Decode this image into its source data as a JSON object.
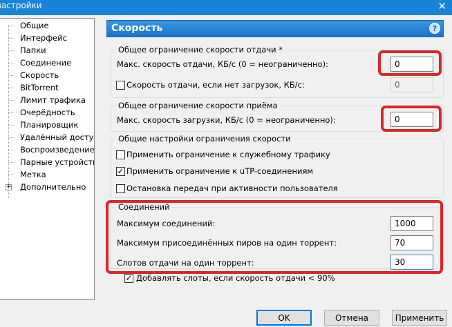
{
  "window": {
    "title": "настройки"
  },
  "tree": [
    {
      "label": "Общие"
    },
    {
      "label": "Интерфейс"
    },
    {
      "label": "Папки"
    },
    {
      "label": "Соединение"
    },
    {
      "label": "Скорость",
      "selected": true
    },
    {
      "label": "BitTorrent"
    },
    {
      "label": "Лимит трафика"
    },
    {
      "label": "Очерёдность"
    },
    {
      "label": "Планировщик"
    },
    {
      "label": "Удалённый доступ"
    },
    {
      "label": "Воспроизведение"
    },
    {
      "label": "Парные устройства"
    },
    {
      "label": "Метка"
    },
    {
      "label": "Дополнительно",
      "expandable": true
    }
  ],
  "header": {
    "title": "Скорость",
    "help": "?"
  },
  "upload": {
    "legend": "Общее ограничение скорости отдачи *",
    "max_label": "Макс. скорость отдачи, КБ/с (0 = неограниченно):",
    "max_value": "0",
    "no_download_label": "Скорость отдачи, если нет загрузок, КБ/с:",
    "no_download_checked": false,
    "no_download_value": "0"
  },
  "download": {
    "legend": "Общее ограничение скорости приёма",
    "max_label": "Макс. скорость загрузки, КБ/с (0 = неограниченно):",
    "max_value": "0"
  },
  "general": {
    "legend": "Общие настройки ограничения скорости",
    "options": [
      {
        "label": "Применить ограничение к служебному трафику",
        "checked": false
      },
      {
        "label": "Применить ограничение к uTP-соединениям",
        "checked": true
      },
      {
        "label": "Остановка передач при активности пользователя",
        "checked": false
      }
    ]
  },
  "connections": {
    "legend": "Соединений",
    "max_label": "Максимум соединений:",
    "max_value": "1000",
    "peers_label": "Максимум присоединённых пиров на один торрент:",
    "peers_value": "70",
    "slots_label": "Слотов отдачи на один торрент:",
    "slots_value": "30",
    "extra_slots_label": "Добавлять слоты, если скорость отдачи < 90%",
    "extra_slots_checked": true
  },
  "buttons": {
    "ok": "OK",
    "cancel": "Отмена",
    "apply": "Применить"
  },
  "colors": {
    "highlight": "#d9272a",
    "accent": "#1a73c8",
    "selection": "#0078d7"
  },
  "icons": {
    "check": "✓",
    "expand": "+",
    "close": "✕"
  }
}
